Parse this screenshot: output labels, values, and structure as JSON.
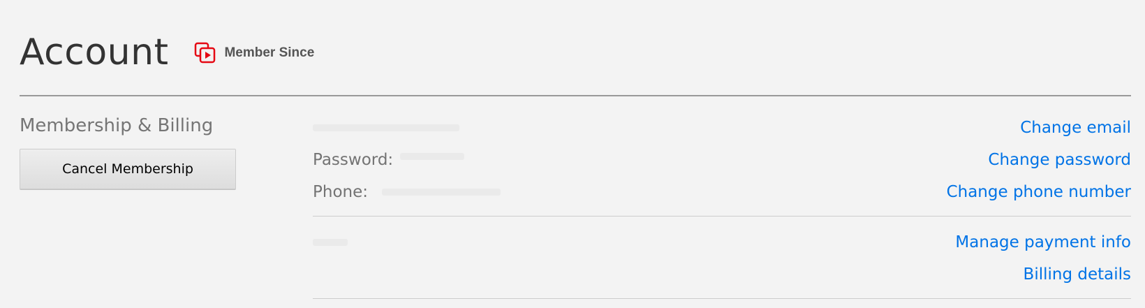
{
  "header": {
    "title": "Account",
    "member_since_label": "Member Since",
    "member_since_icon": "member-since-badge-icon",
    "accent_color": "#e50914"
  },
  "membership": {
    "section_title": "Membership & Billing",
    "cancel_button_label": "Cancel Membership"
  },
  "account_details": {
    "password_label": "Password:",
    "phone_label": "Phone:",
    "change_email_link": "Change email",
    "change_password_link": "Change password",
    "change_phone_link": "Change phone number"
  },
  "billing": {
    "manage_payment_link": "Manage payment info",
    "billing_details_link": "Billing details"
  },
  "colors": {
    "link": "#0073e6",
    "label": "#737373",
    "background": "#f3f3f3"
  }
}
